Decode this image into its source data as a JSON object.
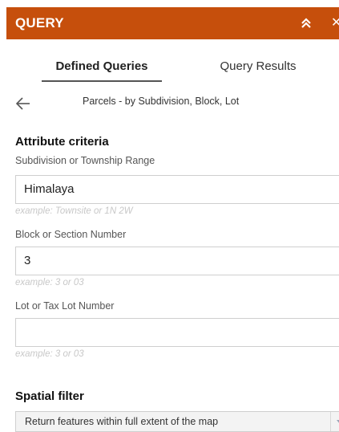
{
  "header": {
    "title": "QUERY",
    "collapse_icon": "double-chevron-up-icon",
    "close_icon": "close-icon",
    "close_glyph": "✕",
    "color": "#c64f0c"
  },
  "tabs": [
    {
      "label": "Defined Queries",
      "active": true
    },
    {
      "label": "Query Results",
      "active": false
    }
  ],
  "query": {
    "back_icon": "arrow-left-icon",
    "name": "Parcels - by Subdivision, Block, Lot"
  },
  "attribute_criteria": {
    "title": "Attribute criteria",
    "fields": [
      {
        "label": "Subdivision or Township Range",
        "value": "Himalaya",
        "hint": "example: Townsite or 1N 2W"
      },
      {
        "label": "Block or Section Number",
        "value": "3",
        "hint": "example: 3 or 03"
      },
      {
        "label": "Lot or Tax Lot Number",
        "value": "",
        "hint": "example: 3 or 03"
      }
    ]
  },
  "spatial_filter": {
    "title": "Spatial filter",
    "selected": "Return features within full extent of the map",
    "arrow_icon": "caret-down-icon"
  }
}
